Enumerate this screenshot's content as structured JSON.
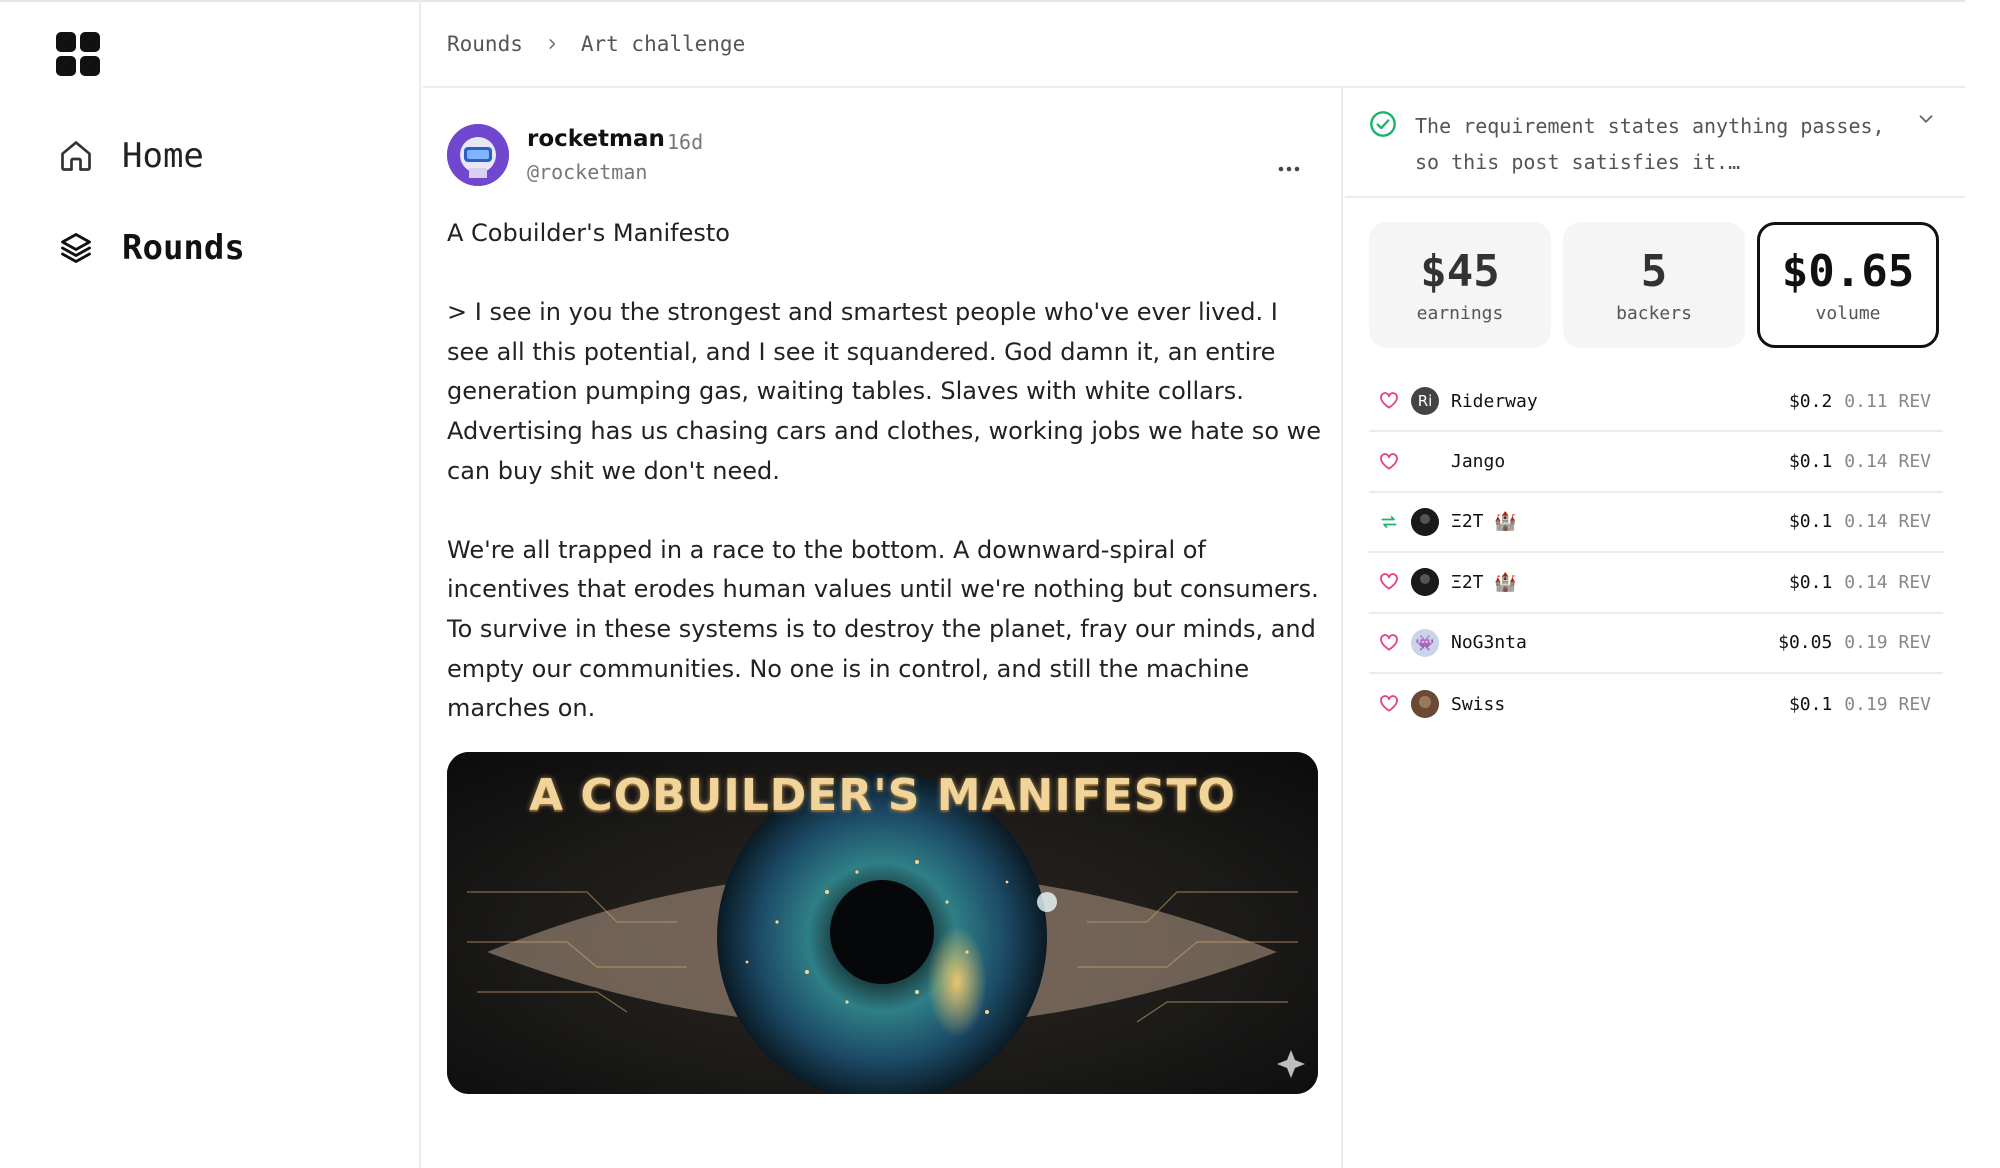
{
  "nav": {
    "items": [
      {
        "label": "Home",
        "icon": "home-icon"
      },
      {
        "label": "Rounds",
        "icon": "layers-icon",
        "active": true
      }
    ]
  },
  "breadcrumb": {
    "items": [
      "Rounds",
      "Art challenge"
    ]
  },
  "post": {
    "author": {
      "name": "rocketman",
      "age": "16d",
      "handle": "@rocketman"
    },
    "title": "A Cobuilder's Manifesto",
    "paragraphs": [
      "> I see in you the strongest and smartest people who've ever lived. I see all this potential, and I see it squandered. God damn it, an entire generation pumping gas, waiting tables. Slaves with white collars. Advertising has us chasing cars and clothes, working jobs we hate so we can buy shit we don't need.",
      "We're all trapped in a race to the bottom. A downward-spiral of incentives that erodes human values until we're nothing but consumers. To survive in these systems is to destroy the planet, fray our minds, and empty our communities. No one is in control, and still the machine marches on."
    ],
    "image_text": "A COBUILDER'S MANIFESTO"
  },
  "requirement": {
    "text": "The requirement states anything passes, so this post satisfies it.…",
    "status": "passed",
    "status_color": "#19b36b"
  },
  "stats": {
    "earnings": {
      "value": "$45",
      "label": "earnings"
    },
    "backers": {
      "value": "5",
      "label": "backers"
    },
    "volume": {
      "value": "$0.65",
      "label": "volume"
    }
  },
  "backers": [
    {
      "action": "like",
      "name": "Riderway",
      "avatar_text": "Ri",
      "avatar_color": "#444444",
      "amount": "$0.2",
      "rev": "0.11 REV"
    },
    {
      "action": "like",
      "name": "Jango",
      "avatar_text": "🕯",
      "avatar_color": "#ffffff",
      "amount": "$0.1",
      "rev": "0.14 REV"
    },
    {
      "action": "recast",
      "name": "Ξ2T 🏰",
      "avatar_text": "",
      "avatar_color": "#1a1a1a",
      "amount": "$0.1",
      "rev": "0.14 REV"
    },
    {
      "action": "like",
      "name": "Ξ2T 🏰",
      "avatar_text": "",
      "avatar_color": "#1a1a1a",
      "amount": "$0.1",
      "rev": "0.14 REV"
    },
    {
      "action": "like",
      "name": "NoG3nta",
      "avatar_text": "👾",
      "avatar_color": "#c9d3ea",
      "amount": "$0.05",
      "rev": "0.19 REV"
    },
    {
      "action": "like",
      "name": "Swiss",
      "avatar_text": "",
      "avatar_color": "#6a4a35",
      "amount": "$0.1",
      "rev": "0.19 REV"
    }
  ],
  "colors": {
    "like": "#e8408a",
    "recast": "#19b36b",
    "border": "#ececec"
  }
}
